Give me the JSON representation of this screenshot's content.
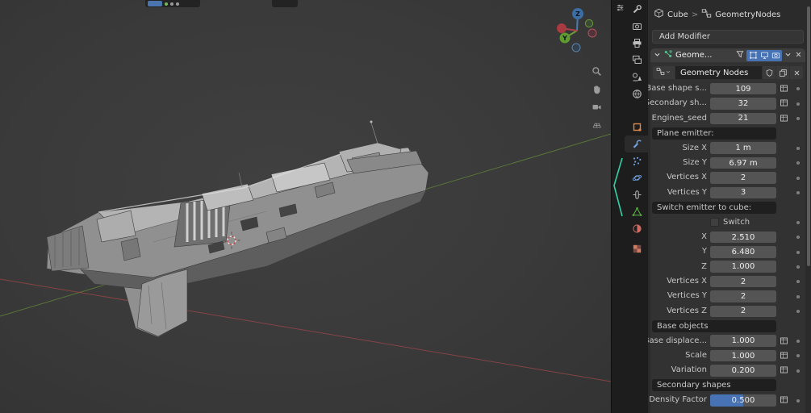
{
  "colors": {
    "accent_blue": "#4772b3",
    "axis_x_red": "#9a4646",
    "axis_y_green": "#5e8038",
    "gizmo_x_red": "#a83a42",
    "gizmo_y_green": "#5e9c30",
    "gizmo_z_blue": "#3a6ea5",
    "slider_fill": "#4772b3"
  },
  "viewport": {
    "gizmo": {
      "z_label": "Z",
      "y_label": "Y"
    },
    "nav_tools": [
      {
        "name": "zoom-icon",
        "icon": "zoom"
      },
      {
        "name": "pan-hand-icon",
        "icon": "hand"
      },
      {
        "name": "camera-view-icon",
        "icon": "cameraview"
      },
      {
        "name": "ortho-grid-icon",
        "icon": "gridpersp"
      }
    ]
  },
  "tabs": [
    {
      "name": "tab-tool",
      "icon": "tool",
      "active": false
    },
    {
      "name": "tab-render",
      "icon": "render",
      "active": false
    },
    {
      "name": "tab-output",
      "icon": "output",
      "active": false
    },
    {
      "name": "tab-view-layer",
      "icon": "viewlayer",
      "active": false
    },
    {
      "name": "tab-scene",
      "icon": "scene",
      "active": false
    },
    {
      "name": "tab-world",
      "icon": "world",
      "active": false
    },
    {
      "name": "tab-object",
      "icon": "object",
      "active": false
    },
    {
      "name": "tab-modifiers",
      "icon": "modifier",
      "active": true
    },
    {
      "name": "tab-particles",
      "icon": "particles",
      "active": false
    },
    {
      "name": "tab-physics",
      "icon": "physics",
      "active": false
    },
    {
      "name": "tab-constraints",
      "icon": "constraint",
      "active": false
    },
    {
      "name": "tab-object-data",
      "icon": "meshdata",
      "active": false
    },
    {
      "name": "tab-material",
      "icon": "material",
      "active": false
    },
    {
      "name": "tab-texture",
      "icon": "texture",
      "active": false
    }
  ],
  "properties_panel": {
    "breadcrumb": {
      "object": "Cube",
      "separator": ">",
      "node_tree": "GeometryNodes"
    },
    "add_modifier": "Add Modifier",
    "modifier": {
      "name": "Geome...",
      "node_group": "Geometry Nodes",
      "display_toggles": [
        {
          "name": "edit-mode-toggle-icon",
          "icon": "editmode"
        },
        {
          "name": "realtime-display-toggle-icon",
          "icon": "monitor"
        },
        {
          "name": "render-display-toggle-icon",
          "icon": "render"
        }
      ]
    },
    "rows": [
      {
        "type": "prop",
        "label": "Base shape s...",
        "value": "109",
        "attr_toggle": true
      },
      {
        "type": "prop",
        "label": "Secondary sh...",
        "value": "32",
        "attr_toggle": true
      },
      {
        "type": "prop",
        "label": "Engines_seed",
        "value": "21",
        "attr_toggle": true
      },
      {
        "type": "section",
        "label": "Plane emitter:"
      },
      {
        "type": "prop",
        "label": "Size X",
        "value": "1 m"
      },
      {
        "type": "prop",
        "label": "Size Y",
        "value": "6.97 m"
      },
      {
        "type": "prop",
        "label": "Vertices X",
        "value": "2"
      },
      {
        "type": "prop",
        "label": "Vertices Y",
        "value": "3"
      },
      {
        "type": "section",
        "label": "Switch emitter to cube:"
      },
      {
        "type": "checkbox",
        "label": "Switch",
        "checked": false
      },
      {
        "type": "prop",
        "label": "X",
        "value": "2.510"
      },
      {
        "type": "prop",
        "label": "Y",
        "value": "6.480"
      },
      {
        "type": "prop",
        "label": "Z",
        "value": "1.000"
      },
      {
        "type": "prop",
        "label": "Vertices X",
        "value": "2"
      },
      {
        "type": "prop",
        "label": "Vertices Y",
        "value": "2"
      },
      {
        "type": "prop",
        "label": "Vertices Z",
        "value": "2"
      },
      {
        "type": "section",
        "label": "Base objects"
      },
      {
        "type": "prop",
        "label": "Base displace...",
        "value": "1.000",
        "attr_toggle": true
      },
      {
        "type": "prop",
        "label": "Scale",
        "value": "1.000",
        "attr_toggle": true
      },
      {
        "type": "prop",
        "label": "Variation",
        "value": "0.200",
        "attr_toggle": true
      },
      {
        "type": "section",
        "label": "Secondary shapes"
      },
      {
        "type": "prop",
        "label": "Density Factor",
        "value": "0.500",
        "attr_toggle": true,
        "slider": 0.5
      }
    ]
  }
}
